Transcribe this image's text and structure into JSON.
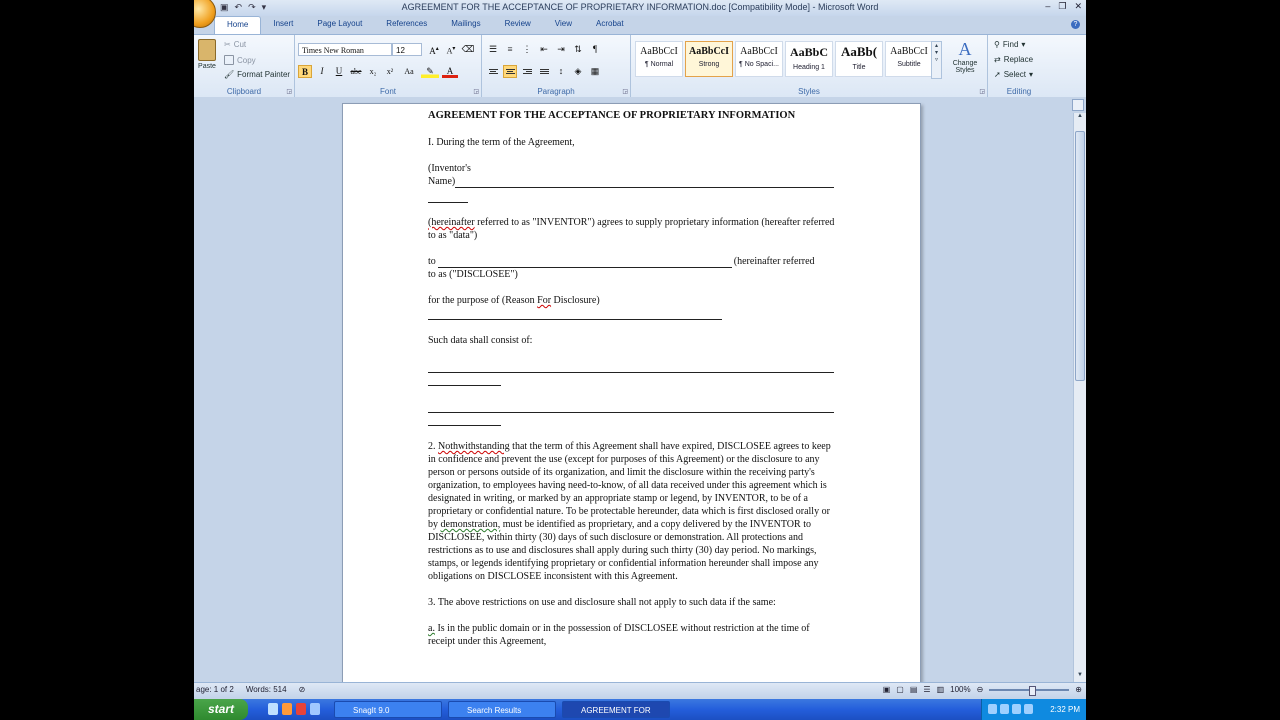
{
  "window": {
    "title": "AGREEMENT FOR THE ACCEPTANCE OF PROPRIETARY INFORMATION.doc [Compatibility Mode] - Microsoft Word"
  },
  "ribbon_tabs": [
    "Home",
    "Insert",
    "Page Layout",
    "References",
    "Mailings",
    "Review",
    "View",
    "Acrobat"
  ],
  "clipboard": {
    "paste": "Paste",
    "cut": "Cut",
    "copy": "Copy",
    "format_painter": "Format Painter",
    "label": "Clipboard"
  },
  "font": {
    "name": "Times New Roman",
    "size": "12",
    "label": "Font",
    "bold": "B",
    "italic": "I",
    "underline": "U",
    "strike": "abe",
    "subscript": "x₂",
    "superscript": "x²",
    "change_case": "Aa",
    "font_color": "A"
  },
  "paragraph": {
    "label": "Paragraph"
  },
  "styles": {
    "label": "Styles",
    "items": [
      {
        "preview": "AaBbCcI",
        "name": "¶ Normal"
      },
      {
        "preview": "AaBbCcI",
        "name": "Strong"
      },
      {
        "preview": "AaBbCcI",
        "name": "¶ No Spaci..."
      },
      {
        "preview": "AaBbC",
        "name": "Heading 1"
      },
      {
        "preview": "AaBb(",
        "name": "Title"
      },
      {
        "preview": "AaBbCcI",
        "name": "Subtitle"
      }
    ],
    "change_styles": "Change Styles"
  },
  "editing": {
    "label": "Editing",
    "find": "Find",
    "replace": "Replace",
    "select": "Select"
  },
  "document": {
    "heading": "AGREEMENT FOR THE ACCEPTANCE OF PROPRIETARY INFORMATION",
    "p1": "I. During the term of the Agreement,",
    "inventor_label_1": "(Inventor's",
    "inventor_label_2": "Name)",
    "hereinafter_word": "(hereinafter",
    "p2_rest": " referred to as \"INVENTOR\") agrees to supply proprietary information (hereafter referred to as \"data\")",
    "to_word": "to",
    "to_rest_1": "(hereinafter referred",
    "to_rest_2": "to as (\"DISCLOSEE\")",
    "purpose_pre": "for the purpose of (Reason ",
    "purpose_for": "For",
    "purpose_post": " Disclosure)",
    "consist": "Such data shall consist of:",
    "s2_num": "2. ",
    "s2_word": "Nothwithstanding",
    "s2_a": " that the term of this Agreement shall have expired, DISCLOSEE agrees to keep in confidence and prevent the use (except for purposes of this Agreement) or the disclosure to any person or persons outside of its organization, and limit the disclosure within the receiving  party's organization, to employees having need-to-know, of all data received under this agreement which is designated in writing, or marked by an appropriate stamp or legend, by INVENTOR, to be of a proprietary or confidential nature. To be protectable hereunder, data which is first disclosed orally or by ",
    "s2_demo": "demonstration,",
    "s2_b": " must be identified as proprietary, and a copy delivered by the INVENTOR to DISCLOSEE, within thirty (30) days of such  disclosure or demonstration. All protections and restrictions as to use and disclosures shall apply during such thirty (30) day period. No markings,  stamps, or legends identifying proprietary or confidential information hereunder shall impose any obligations on DISCLOSEE inconsistent with this Agreement.",
    "s3": "3. The above restrictions on use and disclosure shall not apply to such data if the same:",
    "sa_a": "a.",
    "sa_rest": " Is in the public domain or in the possession  of DISCLOSEE without restriction at the time of receipt under this Agreement,"
  },
  "statusbar": {
    "page": "age: 1 of 2",
    "words": "Words: 514",
    "zoom": "100%"
  },
  "taskbar": {
    "start": "start",
    "tasks": [
      "SnagIt 9.0",
      "Search Results",
      "AGREEMENT FOR TH..."
    ],
    "clock": "2:32 PM"
  }
}
